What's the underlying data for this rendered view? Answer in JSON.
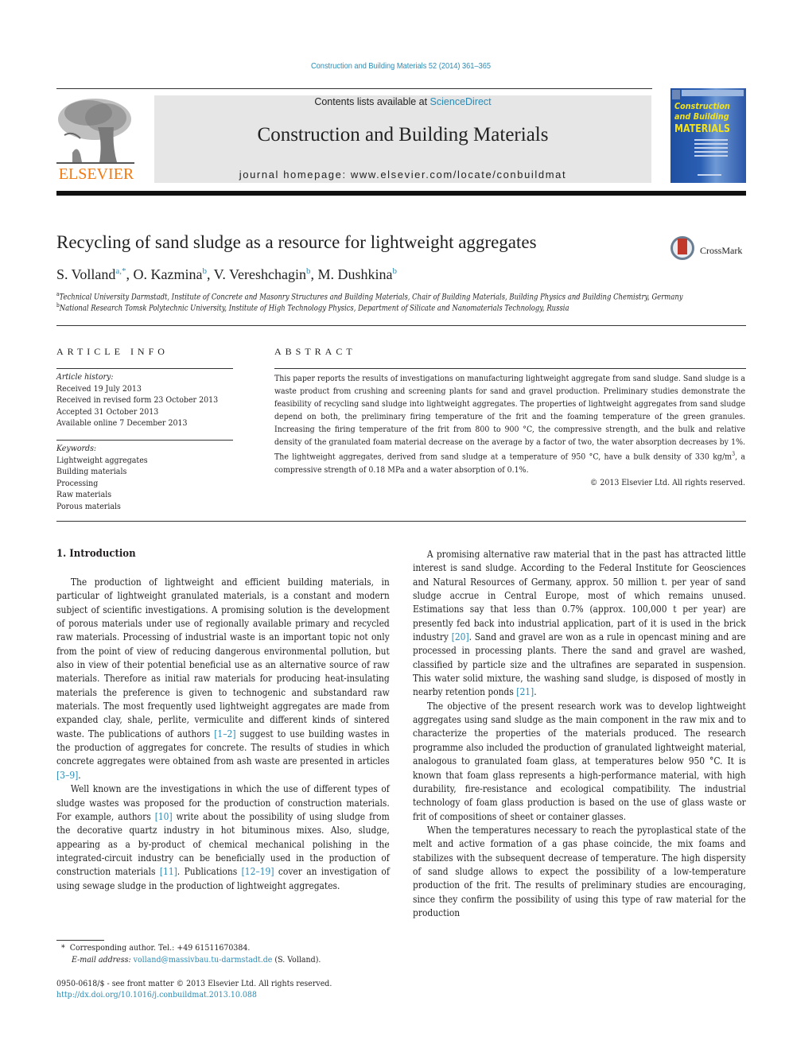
{
  "header": {
    "journal_reference": "Construction and Building Materials 52 (2014) 361–365",
    "contents_prefix": "Contents lists available at ",
    "contents_link": "ScienceDirect",
    "journal_title": "Construction and Building Materials",
    "homepage": "journal homepage: www.elsevier.com/locate/conbuildmat",
    "publisher_logo_text": "ELSEVIER",
    "cover": {
      "line1": "Construction",
      "line2": "and Building",
      "line3": "MATERIALS"
    },
    "colors": {
      "link": "#2a8bb5",
      "elsevier_orange": "#f07b13",
      "cover_blue": "#1f4fa0",
      "cover_yellow": "#f3e219"
    }
  },
  "article": {
    "title": "Recycling of sand sludge as a resource for lightweight aggregates",
    "crossmark_label": "CrossMark",
    "authors": [
      {
        "name": "S. Volland",
        "sup": "a,*"
      },
      {
        "name": "O. Kazmina",
        "sup": "b"
      },
      {
        "name": "V. Vereshchagin",
        "sup": "b"
      },
      {
        "name": "M. Dushkina",
        "sup": "b"
      }
    ],
    "affiliations": [
      {
        "sup": "a",
        "text": "Technical University Darmstadt, Institute of Concrete and Masonry Structures and Building Materials, Chair of Building Materials, Building Physics and Building Chemistry, Germany"
      },
      {
        "sup": "b",
        "text": "National Research Tomsk Polytechnic University, Institute of High Technology Physics, Department of Silicate and Nanomaterials Technology, Russia"
      }
    ]
  },
  "article_info": {
    "heading": "ARTICLE INFO",
    "history_label": "Article history:",
    "history": [
      "Received 19 July 2013",
      "Received in revised form 23 October 2013",
      "Accepted 31 October 2013",
      "Available online 7 December 2013"
    ],
    "keywords_label": "Keywords:",
    "keywords": [
      "Lightweight aggregates",
      "Building materials",
      "Processing",
      "Raw materials",
      "Porous materials"
    ]
  },
  "abstract": {
    "heading": "ABSTRACT",
    "text_part1": "This paper reports the results of investigations on manufacturing lightweight aggregate from sand sludge. Sand sludge is a waste product from crushing and screening plants for sand and gravel production. Preliminary studies demonstrate the feasibility of recycling sand sludge into lightweight aggregates. The properties of lightweight aggregates from sand sludge depend on both, the preliminary firing temperature of the frit and the foaming temperature of the green granules. Increasing the firing temperature of the frit from 800 to 900 °C, the compressive strength, and the bulk and relative density of the granulated foam material decrease on the average by a factor of two, the water absorption decreases by 1%. The lightweight aggregates, derived from sand sludge at a temperature of 950 °C, have a bulk density of 330 kg/m",
    "text_sup": "3",
    "text_part2": ", a compressive strength of 0.18 MPa and a water absorption of 0.1%.",
    "copyright": "© 2013 Elsevier Ltd. All rights reserved."
  },
  "introduction": {
    "heading": "1. Introduction",
    "left_col": {
      "p1_a": "The production of lightweight and efficient building materials, in particular of lightweight granulated materials, is a constant and modern subject of scientific investigations. A promising solution is the development of porous materials under use of regionally available primary and recycled raw materials. Processing of industrial waste is an important topic not only from the point of view of reducing dangerous environmental pollution, but also in view of their potential beneficial use as an alternative source of raw materials. Therefore as initial raw materials for producing heat-insulating materials the preference is given to technogenic and substandard raw materials. The most frequently used lightweight aggregates are made from expanded clay, shale, perlite, vermiculite and different kinds of sintered waste. The publications of authors ",
      "ref1": "[1–2]",
      "p1_b": " suggest to use building wastes in the production of aggregates for concrete. The results of studies in which concrete aggregates were obtained from ash waste are presented in articles ",
      "ref2": "[3–9]",
      "p1_c": ".",
      "p2_a": "Well known are the investigations in which the use of different types of sludge wastes was proposed for the production of construction materials. For example, authors ",
      "ref3": "[10]",
      "p2_b": " write about the possibility of using sludge from the decorative quartz industry in hot bituminous mixes. Also, sludge, appearing as a by-product of chemical mechanical polishing in the integrated-circuit industry can be beneficially used in the production of construction materials ",
      "ref4": "[11]",
      "p2_c": ". Publications ",
      "ref5": "[12–19]",
      "p2_d": " cover an investigation of using sewage sludge in the production of lightweight aggregates."
    },
    "right_col": {
      "p1_a": "A promising alternative raw material that in the past has attracted little interest is sand sludge. According to the Federal Institute for Geosciences and Natural Resources of Germany, approx. 50 million t. per year of sand sludge accrue in Central Europe, most of which remains unused. Estimations say that less than 0.7% (approx. 100,000 t per year) are presently fed back into industrial application, part of it is used in the brick industry ",
      "ref1": "[20]",
      "p1_b": ". Sand and gravel are won as a rule in opencast mining and are processed in processing plants. There the sand and gravel are washed, classified by particle size and the ultrafines are separated in suspension. This water solid mixture, the washing sand sludge, is disposed of mostly in nearby retention ponds ",
      "ref2": "[21]",
      "p1_c": ".",
      "p2": "The objective of the present research work was to develop lightweight aggregates using sand sludge as the main component in the raw mix and to characterize the properties of the materials produced. The research programme also included the production of granulated lightweight material, analogous to granulated foam glass, at temperatures below 950 °C. It is known that foam glass represents a high-performance material, with high durability, fire-resistance and ecological compatibility. The industrial technology of foam glass production is based on the use of glass waste or frit of compositions of sheet or container glasses.",
      "p3": "When the temperatures necessary to reach the pyroplastical state of the melt and active formation of a gas phase coincide, the mix foams and stabilizes with the subsequent decrease of temperature. The high dispersity of sand sludge allows to expect the possibility of a low-temperature production of the frit. The results of preliminary studies are encouraging, since they confirm the possibility of using this type of raw material for the production"
    }
  },
  "footnotes": {
    "star": "*",
    "corresponding": "Corresponding author. Tel.: +49 61511670384.",
    "email_label": "E-mail address:",
    "email": "volland@massivbau.tu-darmstadt.de",
    "email_suffix": " (S. Volland).",
    "issn_line": "0950-0618/$ - see front matter © 2013 Elsevier Ltd. All rights reserved.",
    "doi": "http://dx.doi.org/10.1016/j.conbuildmat.2013.10.088"
  }
}
